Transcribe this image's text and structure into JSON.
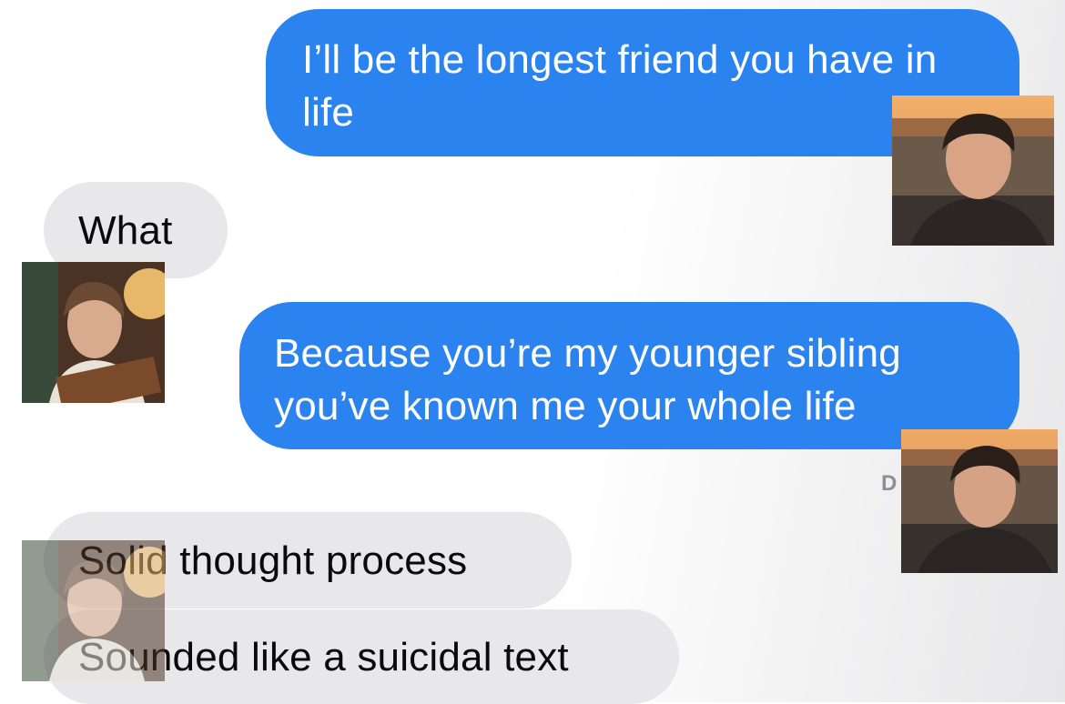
{
  "messages": [
    {
      "sender": "sent",
      "text": "I’ll be the longest friend you have in life"
    },
    {
      "sender": "received",
      "text": "What"
    },
    {
      "sender": "sent",
      "text": "Because you’re my younger sibling you’ve known me your whole life"
    },
    {
      "sender": "received",
      "text": "Solid thought process"
    },
    {
      "sender": "received",
      "text": "Sounded like a suicidal text"
    }
  ],
  "status_fragment": "D",
  "colors": {
    "sent_bubble": "#2a83ef",
    "received_bubble": "#e8e8ea",
    "sent_text": "#ffffff",
    "received_text": "#0a0a0a"
  },
  "icons": [
    "avatar-sender-photo",
    "avatar-receiver-photo"
  ]
}
